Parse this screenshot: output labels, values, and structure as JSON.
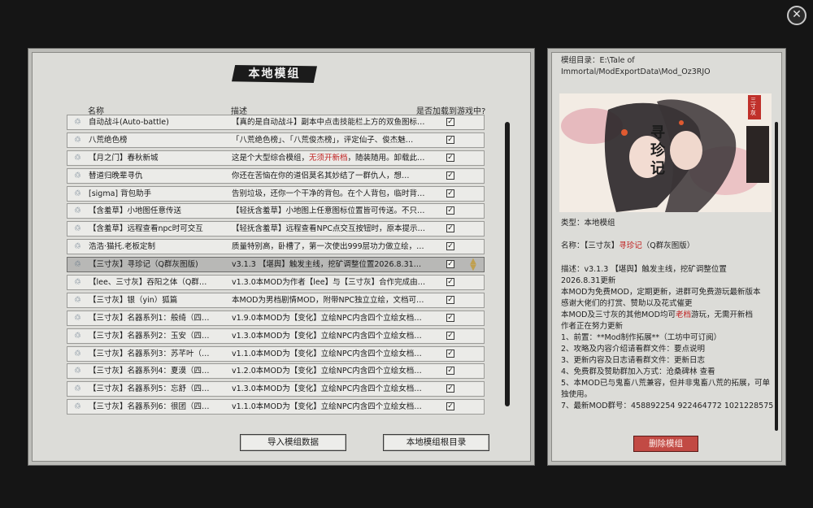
{
  "close_label": "✕",
  "left_panel": {
    "title": "本地模组",
    "headers": {
      "name": "名称",
      "desc": "描述",
      "load": "是否加载到游戏中?"
    },
    "mods": [
      {
        "name": "自动战斗(Auto-battle)",
        "desc_pre": "【真的是自动战斗】副本中点击技能栏上方的双鱼图标…",
        "desc_red": "",
        "desc_post": "",
        "checked": "✓"
      },
      {
        "name": "八荒绝色榜",
        "desc_pre": "「八荒绝色榜」、「八荒俊杰榜」，评定仙子、俊杰魅…",
        "desc_red": "",
        "desc_post": "",
        "checked": "✓"
      },
      {
        "name": "【月之门】春秋新城",
        "desc_pre": "这是个大型综合模组，",
        "desc_red": "无须开新档",
        "desc_post": "，随装随用。卸载此…",
        "checked": "✓"
      },
      {
        "name": "替道归晚辈寻仇",
        "desc_pre": "你还在苦恼在你的道侣莫名其妙结了一群仇人，想…",
        "desc_red": "",
        "desc_post": "",
        "checked": "✓"
      },
      {
        "name": "[sigma] 背包助手",
        "desc_pre": "告别垃圾，还你一个干净的背包。在个人背包，临时背…",
        "desc_red": "",
        "desc_post": "",
        "checked": "✓"
      },
      {
        "name": "【含羞草】小地图任意传送",
        "desc_pre": "【轻抚含羞草】小地图上任意图标位置皆可传送。不只…",
        "desc_red": "",
        "desc_post": "",
        "checked": "✓"
      },
      {
        "name": "【含羞草】远程查看npc时可交互",
        "desc_pre": "【轻抚含羞草】远程查看NPC点交互按钮时，原本提示…",
        "desc_red": "",
        "desc_post": "",
        "checked": "✓"
      },
      {
        "name": "浩浩·猫托.老板定制",
        "desc_pre": "质量特别高，卧槽了，第一次使出999层功力做立绘，…",
        "desc_red": "",
        "desc_post": "",
        "checked": "✓"
      },
      {
        "name": "【三寸灰】寻珍记（Q群灰图版)",
        "desc_pre": "v3.1.3 【堪舆】触发主线，挖矿调整位置2026.8.31更新…",
        "desc_red": "",
        "desc_post": "",
        "checked": "✓"
      },
      {
        "name": "【lee、三寸灰】吞阳之体（Q群版）",
        "desc_pre": "v1.3.0本MOD为作者【lee】与【三寸灰】合作完成由群…",
        "desc_red": "",
        "desc_post": "",
        "checked": "✓"
      },
      {
        "name": "【三寸灰】银（yin）狐篇",
        "desc_pre": "本MOD为男档剧情MOD，附带NPC独立立绘，文档可…",
        "desc_red": "",
        "desc_post": "",
        "checked": "✓"
      },
      {
        "name": "【三寸灰】名器系列1：般绮（四个…",
        "desc_pre": "v1.9.0本MOD为【变化】立绘NPC内含四个立绘女档玩…",
        "desc_red": "",
        "desc_post": "",
        "checked": "✓"
      },
      {
        "name": "【三寸灰】名器系列2：玉安（四个…",
        "desc_pre": "v1.3.0本MOD为【变化】立绘NPC内含四个立绘女档玩…",
        "desc_red": "",
        "desc_post": "",
        "checked": "✓"
      },
      {
        "name": "【三寸灰】名器系列3：苏芊叶（四…",
        "desc_pre": "v1.1.0本MOD为【变化】立绘NPC内含四个立绘女档玩…",
        "desc_red": "",
        "desc_post": "",
        "checked": "✓"
      },
      {
        "name": "【三寸灰】名器系列4：夏漠（四个…",
        "desc_pre": "v1.2.0本MOD为【变化】立绘NPC内含四个立绘女档玩…",
        "desc_red": "",
        "desc_post": "",
        "checked": "✓"
      },
      {
        "name": "【三寸灰】名器系列5：忘舒（四个…",
        "desc_pre": "v1.3.0本MOD为【变化】立绘NPC内含四个立绘女档玩…",
        "desc_red": "",
        "desc_post": "",
        "checked": "✓"
      },
      {
        "name": "【三寸灰】名器系列6：很团（四个…",
        "desc_pre": "v1.1.0本MOD为【变化】立绘NPC内含四个立绘女档玩…",
        "desc_red": "",
        "desc_post": "",
        "checked": "✓"
      }
    ],
    "selected_index": 8,
    "import_button": "导入模组数据",
    "root_button": "本地模组根目录"
  },
  "right_panel": {
    "dir_label": "模组目录：E:\\Tale of Immortal/ModExportData\\Mod_Oz3RJO",
    "preview_title": "寻珍记",
    "preview_seal": "三寸灰",
    "type_line": "类型：本地模组",
    "name_pre": "名称：【三寸灰】",
    "name_red": "寻珍记",
    "name_post": "（Q群灰图版）",
    "desc_lines": [
      "描述：v3.1.3 【堪舆】触发主线，挖矿调整位置",
      "2026.8.31更新",
      "本MOD为免费MOD，定期更新，进群可免费游玩最新版本",
      "感谢大佬们的打赏、赞助以及花式催更"
    ],
    "note_pre": "本MOD及三寸灰的其他MOD均可",
    "note_red": "老档",
    "note_post": "游玩，无需开新档",
    "more_lines": [
      "作者正在努力更新",
      "1、前置：**Mod制作拓展**（工坊中可订阅）",
      "2、攻略及内容介绍请看群文件：要点说明",
      "3、更新内容及日志请看群文件：更新日志",
      "4、免费群及赞助群加入方式：沧桑碑林 查看",
      "5、本MOD已与鬼畜八荒兼容，但并非鬼畜八荒的拓展，可单",
      "独使用。",
      "7、最新MOD群号：458892254 922464772 1021228575"
    ],
    "delete_button": "删除模组"
  },
  "colors": {
    "accent_red": "#c02020",
    "delete_bg": "#c24a44"
  }
}
